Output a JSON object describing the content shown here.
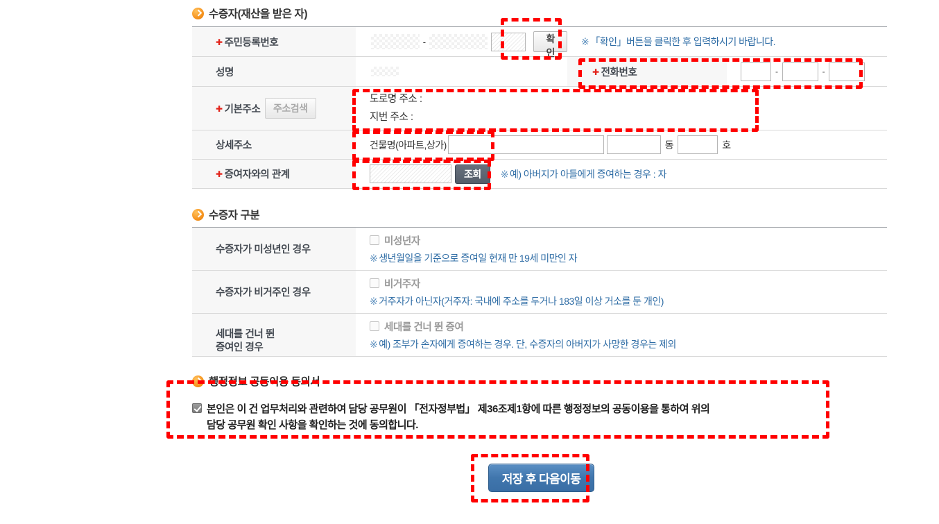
{
  "sections": {
    "donee": {
      "title": "수증자(재산을 받은 자)",
      "icon": "chevron-circle-icon"
    },
    "donee_type": {
      "title": "수증자 구분",
      "icon": "chevron-circle-icon"
    },
    "consent": {
      "title": "행정정보 공동이용 동의서",
      "icon": "chevron-circle-icon"
    }
  },
  "donee_table": {
    "rows": {
      "ssn": {
        "label": "주민등록번호",
        "required": true,
        "value_front": "",
        "value_back": "",
        "separator": "-",
        "confirm_button": "확인",
        "note": "「확인」버튼을 클릭한 후 입력하시기 바랍니다.",
        "note_mark": "※"
      },
      "name": {
        "label": "성명",
        "required": false,
        "value": ""
      },
      "phone": {
        "label": "전화번호",
        "required": true,
        "part1": "",
        "part2": "",
        "part3": "",
        "sep1": "-",
        "sep2": "-"
      },
      "base_address": {
        "label": "기본주소",
        "required": true,
        "search_button": "주소검색",
        "road_label": "도로명 주소 :",
        "lot_label": "지번 주소 :"
      },
      "detail_address": {
        "label": "상세주소",
        "required": false,
        "building_label": "건물명(아파트,상가)",
        "building_value": "",
        "dong_value": "",
        "dong_unit": "동",
        "ho_value": "",
        "ho_unit": "호"
      },
      "relation": {
        "label": "증여자와의 관계",
        "required": true,
        "value": "",
        "lookup_button": "조회",
        "note": "예) 아버지가 아들에게 증여하는 경우 : 자",
        "note_mark": "※"
      }
    }
  },
  "donee_type_table": {
    "rows": [
      {
        "label": "수증자가 미성년인 경우",
        "checkbox_label": "미성년자",
        "checked": false,
        "note_mark": "※",
        "note": "생년월일을 기준으로 증여일 현재 만 19세 미만인 자"
      },
      {
        "label": "수증자가 비거주인 경우",
        "checkbox_label": "비거주자",
        "checked": false,
        "note_mark": "※",
        "note": "거주자가 아닌자(거주자: 국내에 주소를 두거나 183일 이상 거소를 둔 개인)"
      },
      {
        "label": "세대를 건너 뛴\n증여인 경우",
        "checkbox_label": "세대를 건너 뛴 증여",
        "checked": false,
        "note_mark": "※",
        "note": "예) 조부가 손자에게 증여하는 경우. 단, 수증자의 아버지가 사망한 경우는 제외"
      }
    ]
  },
  "consent": {
    "checked": true,
    "text": "본인은 이 건 업무처리와 관련하여 담당 공무원이 「전자정부법」 제36조제1항에 따른 행정정보의 공동이용을 통하여 위의\n담당 공무원 확인 사항을 확인하는 것에 동의합니다."
  },
  "footer": {
    "submit_button": "저장 후 다음이동"
  },
  "colors": {
    "accent_orange": "#f6931e",
    "required_red": "#e2231a",
    "note_blue": "#2e6ca5",
    "primary_button": "#3a6ea5",
    "annotation_red": "#ff0000",
    "label_bg": "#f7f7f7",
    "border_gray": "#d8d8d8"
  }
}
